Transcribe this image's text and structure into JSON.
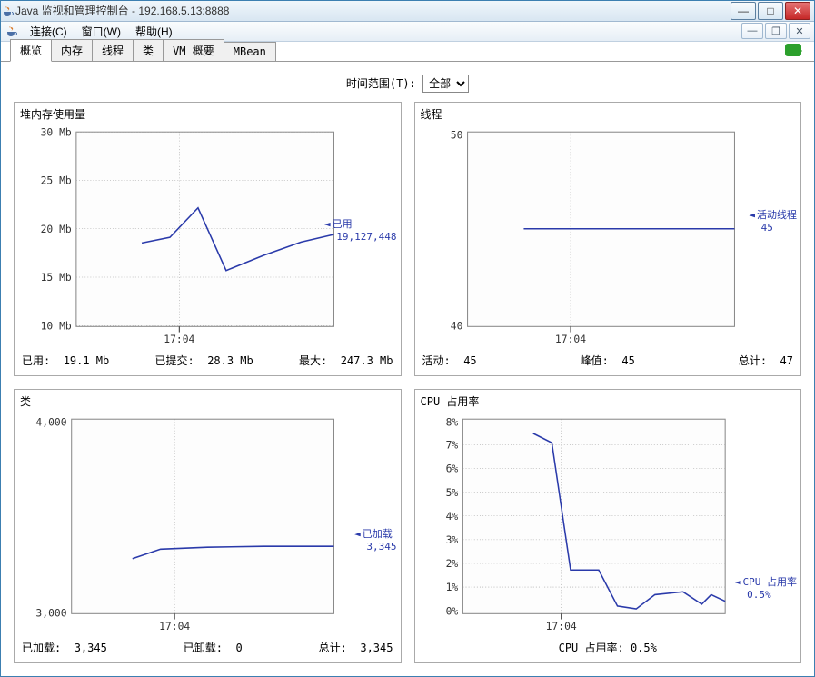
{
  "window": {
    "title": "Java 监视和管理控制台 - 192.168.5.13:8888"
  },
  "menu": {
    "connect": "连接(C)",
    "window": "窗口(W)",
    "help": "帮助(H)"
  },
  "tabs": {
    "overview": "概览",
    "memory": "内存",
    "threads": "线程",
    "classes": "类",
    "vm": "VM 概要",
    "mbean": "MBean"
  },
  "range": {
    "label": "时间范围(T):",
    "value": "全部"
  },
  "heap": {
    "title": "堆内存使用量",
    "legend_label": "已用",
    "legend_value": "19,127,448",
    "footer_used_label": "已用:",
    "footer_used_value": "19.1 Mb",
    "footer_committed_label": "已提交:",
    "footer_committed_value": "28.3 Mb",
    "footer_max_label": "最大:",
    "footer_max_value": "247.3 Mb",
    "xtick": "17:04"
  },
  "threads": {
    "title": "线程",
    "legend_label": "活动线程",
    "legend_value": "45",
    "footer_live_label": "活动:",
    "footer_live_value": "45",
    "footer_peak_label": "峰值:",
    "footer_peak_value": "45",
    "footer_total_label": "总计:",
    "footer_total_value": "47",
    "xtick": "17:04"
  },
  "classes": {
    "title": "类",
    "legend_label": "已加载",
    "legend_value": "3,345",
    "footer_loaded_label": "已加载:",
    "footer_loaded_value": "3,345",
    "footer_unloaded_label": "已卸载:",
    "footer_unloaded_value": "0",
    "footer_total_label": "总计:",
    "footer_total_value": "3,345",
    "xtick": "17:04"
  },
  "cpu": {
    "title": "CPU 占用率",
    "legend_label": "CPU 占用率",
    "legend_value": "0.5%",
    "footer_label": "CPU 占用率:",
    "footer_value": "0.5%",
    "xtick": "17:04"
  },
  "chart_data": [
    {
      "type": "line",
      "title": "堆内存使用量",
      "xlabel": "",
      "ylabel": "",
      "ylim": [
        10,
        30
      ],
      "yunit": "Mb",
      "yticks": [
        10,
        15,
        20,
        25,
        30
      ],
      "xticks": [
        "17:04"
      ],
      "series": [
        {
          "name": "已用",
          "values": [
            18.5,
            19.2,
            22.0,
            15.7,
            17.0,
            18.2,
            19.1
          ]
        }
      ],
      "current": 19127448
    },
    {
      "type": "line",
      "title": "线程",
      "xlabel": "",
      "ylabel": "",
      "ylim": [
        40,
        50
      ],
      "yticks": [
        40,
        50
      ],
      "xticks": [
        "17:04"
      ],
      "series": [
        {
          "name": "活动线程",
          "values": [
            45,
            45,
            45,
            45,
            45,
            45,
            45
          ]
        }
      ],
      "current": 45
    },
    {
      "type": "line",
      "title": "类",
      "xlabel": "",
      "ylabel": "",
      "ylim": [
        3000,
        4000
      ],
      "yticks": [
        3000,
        4000
      ],
      "xticks": [
        "17:04"
      ],
      "series": [
        {
          "name": "已加载",
          "values": [
            3280,
            3330,
            3340,
            3342,
            3344,
            3345,
            3345
          ]
        }
      ],
      "current": 3345
    },
    {
      "type": "line",
      "title": "CPU 占用率",
      "xlabel": "",
      "ylabel": "",
      "ylim": [
        0,
        8
      ],
      "yunit": "%",
      "yticks": [
        0,
        1,
        2,
        3,
        4,
        5,
        6,
        7,
        8
      ],
      "xticks": [
        "17:04"
      ],
      "series": [
        {
          "name": "CPU 占用率",
          "values": [
            7.4,
            7.0,
            1.8,
            1.8,
            0.3,
            0.2,
            0.8,
            0.9,
            0.4,
            0.8,
            0.5
          ]
        }
      ],
      "current": 0.5
    }
  ]
}
